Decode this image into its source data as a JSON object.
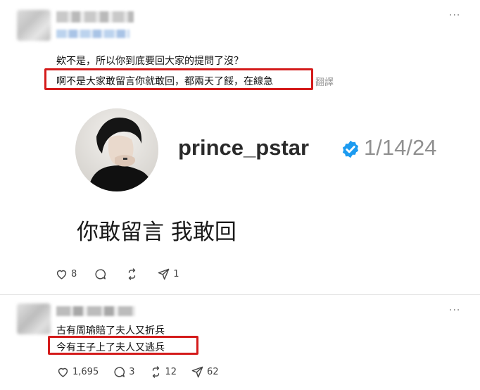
{
  "post1": {
    "more_label": "···",
    "line1": "欸不是，所以你到底要回大家的提問了沒？",
    "line2": "啊不是大家敢留言你就敢回，都兩天了餒，在線急",
    "translate_label": "翻譯",
    "embed": {
      "username": "prince_pstar",
      "date": "1/14/24",
      "text": "你敢留言 我敢回"
    },
    "stats": {
      "likes": "8",
      "replies": "",
      "reposts": "",
      "shares": "1"
    }
  },
  "post2": {
    "more_label": "···",
    "line1": "古有周瑜賠了夫人又折兵",
    "line2": "今有王子上了夫人又逃兵",
    "stats": {
      "likes": "1,695",
      "replies": "3",
      "reposts": "12",
      "shares": "62"
    }
  },
  "colors": {
    "highlight": "#d41b1b",
    "verified": "#1d9bf0"
  },
  "icons": [
    "heart-icon",
    "reply-icon",
    "repost-icon",
    "share-icon",
    "verified-badge-icon",
    "more-icon"
  ]
}
